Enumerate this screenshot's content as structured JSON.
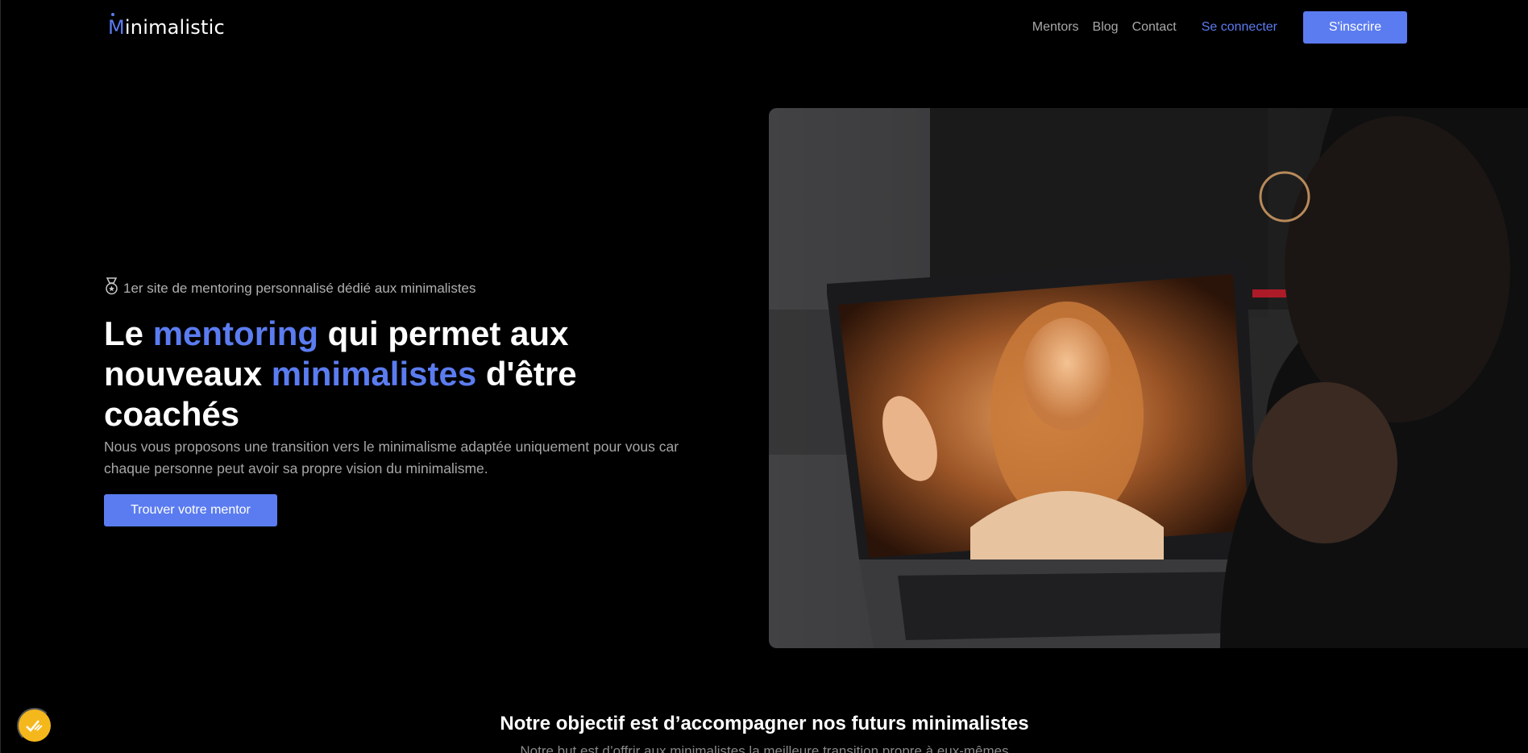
{
  "header": {
    "logo_initial": "M",
    "logo_rest": "inimalistic",
    "nav": [
      {
        "label": "Mentors"
      },
      {
        "label": "Blog"
      },
      {
        "label": "Contact"
      }
    ],
    "login_label": "Se connecter",
    "signup_label": "S'inscrire"
  },
  "hero": {
    "eyebrow": "1er site de mentoring personnalisé dédié aux minimalistes",
    "title_part1": "Le ",
    "title_accent1": "mentoring",
    "title_part2": " qui permet aux nouveaux ",
    "title_accent2": "minimalistes",
    "title_part3": " d'être coachés",
    "description": "Nous vous proposons une transition vers le minimalisme adaptée uniquement pour vous car chaque personne peut avoir sa propre vision du minimalisme.",
    "cta_label": "Trouver votre mentor"
  },
  "section": {
    "title": "Notre objectif est d’accompagner nos futurs minimalistes",
    "subtitle": "Notre but est d’offrir aux minimalistes la meilleure transition propre à eux-mêmes"
  },
  "colors": {
    "accent": "#5b7cf0",
    "background": "#000000",
    "fab": "#f5b81c"
  },
  "icons": {
    "eyebrow": "medal-icon",
    "fab": "cookie-settings-icon"
  }
}
